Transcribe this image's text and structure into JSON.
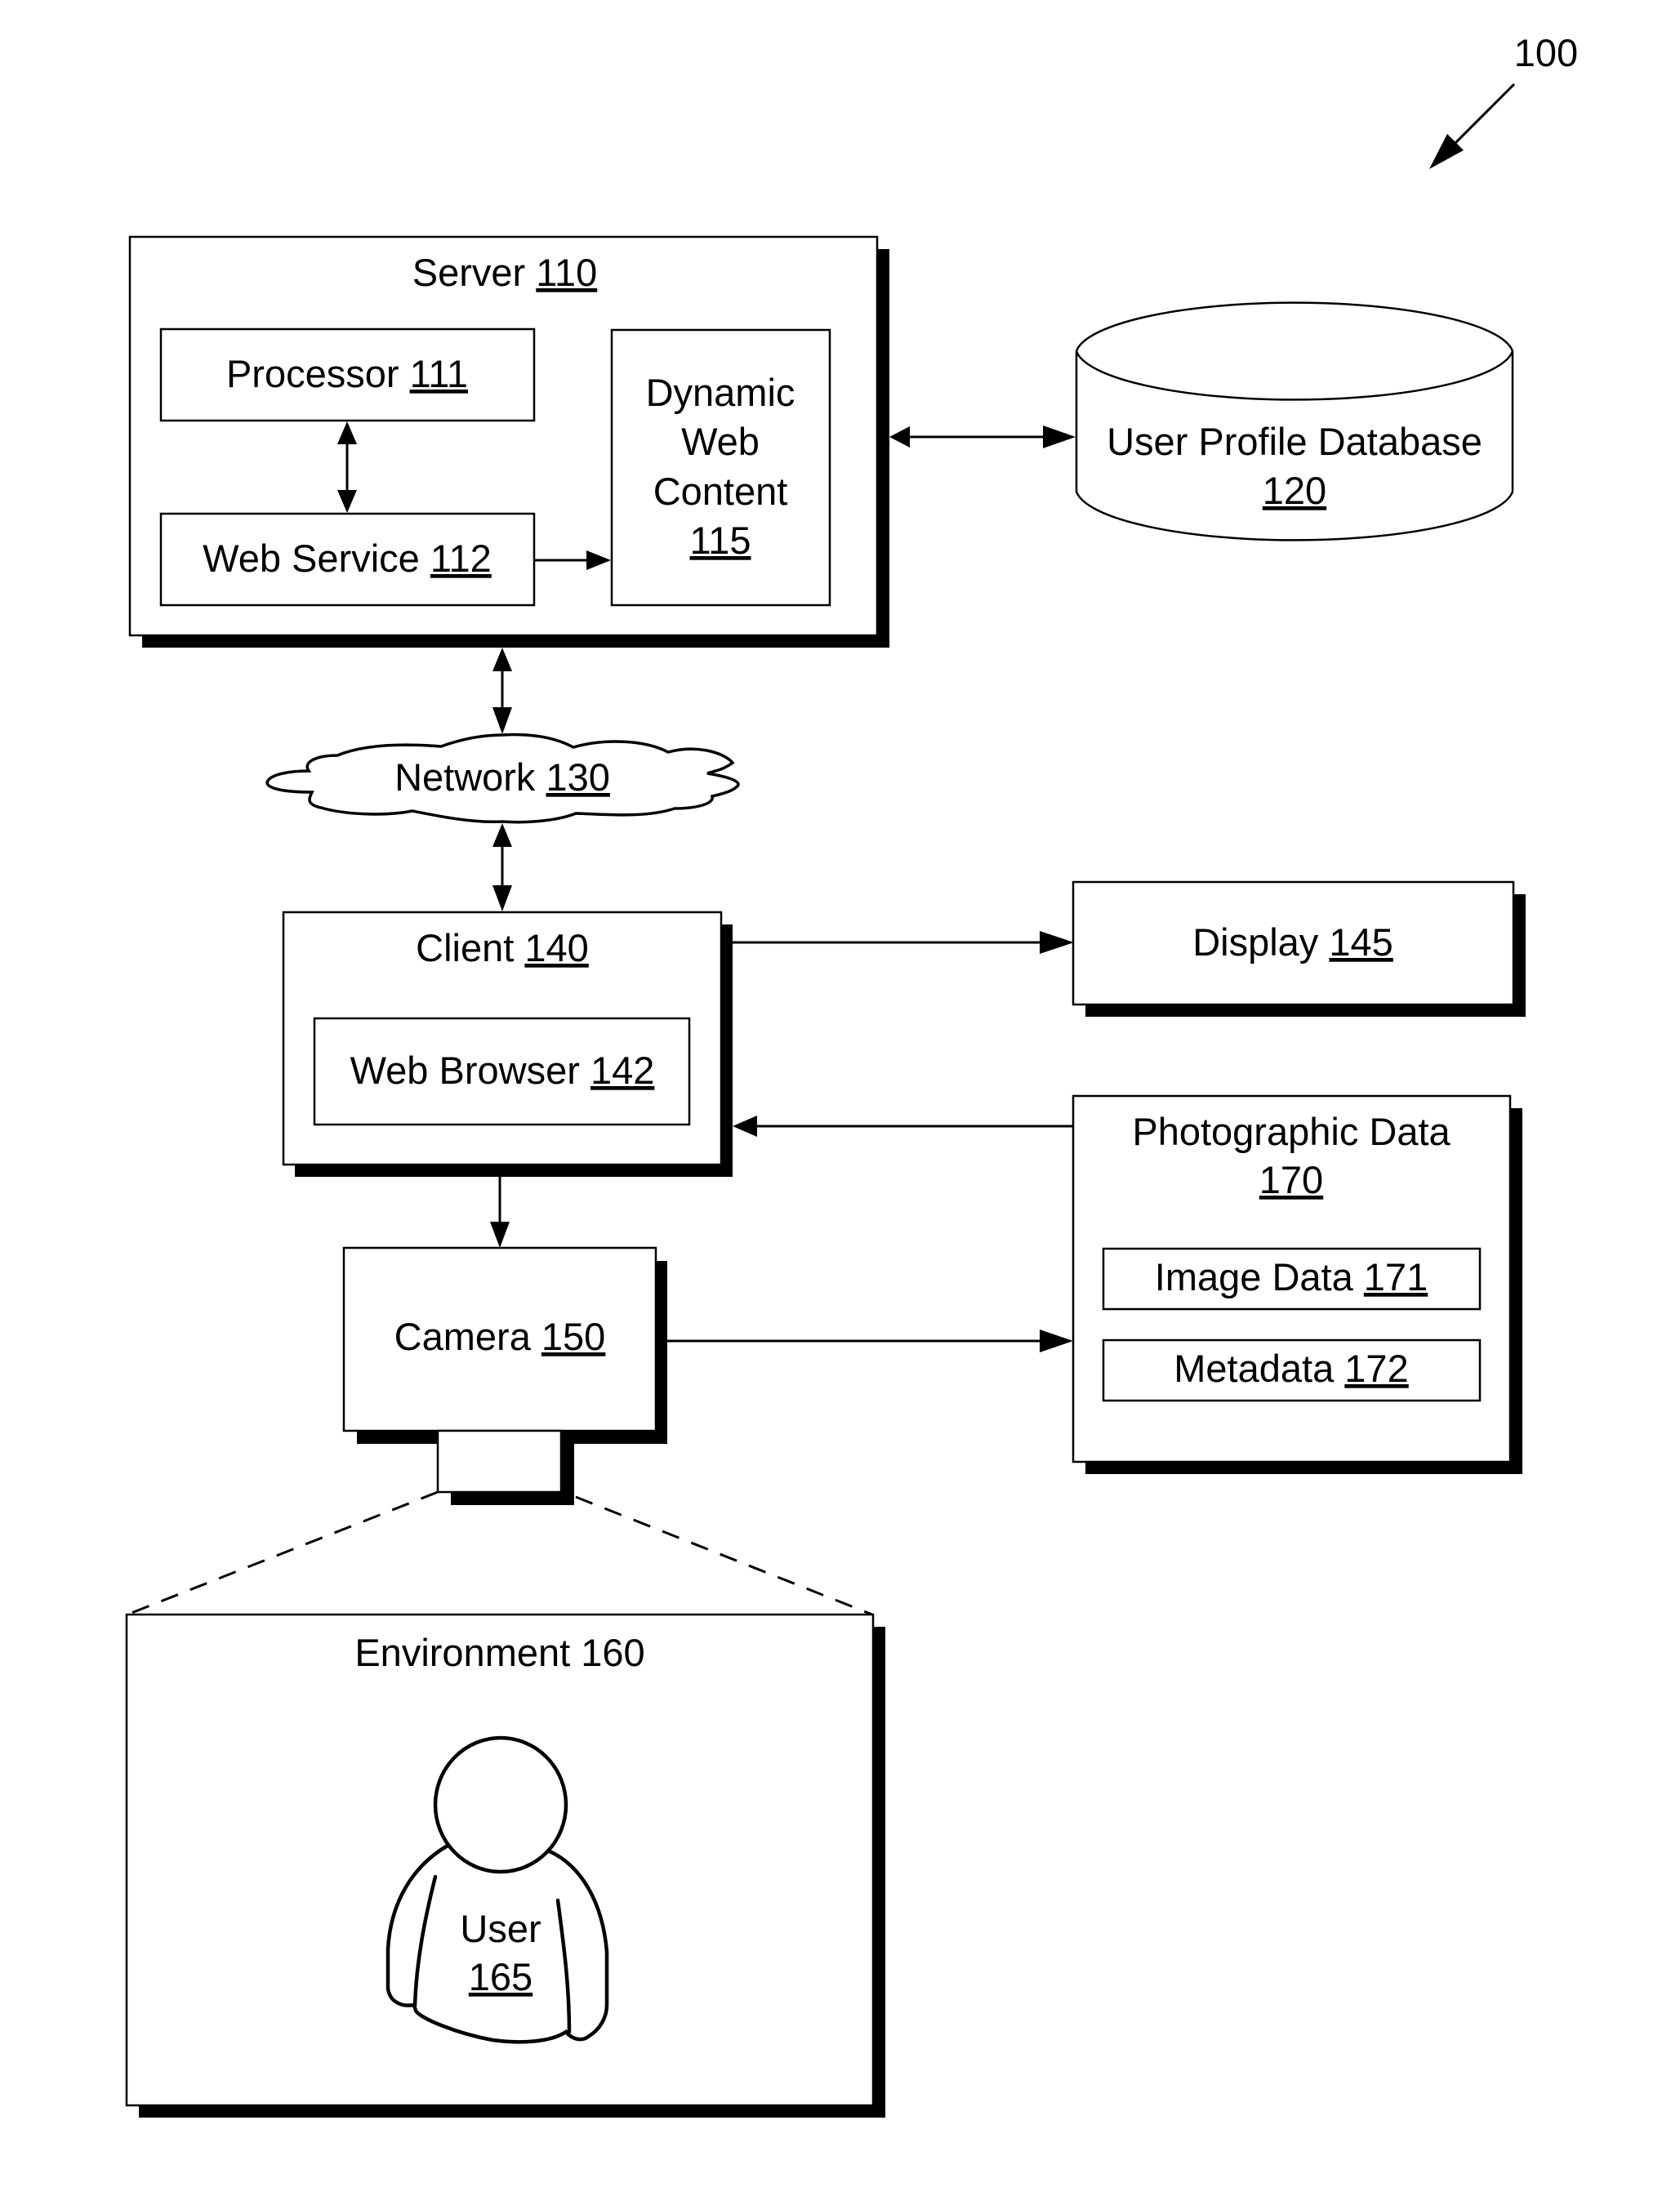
{
  "figure": {
    "reference": "100",
    "colors": {
      "ink": "#000000",
      "background": "#ffffff"
    }
  },
  "server": {
    "label": "Server",
    "ref": "110",
    "processor": {
      "label": "Processor",
      "ref": "111"
    },
    "web_service": {
      "label": "Web Service",
      "ref": "112"
    },
    "dynamic_web_content": {
      "lines": [
        "Dynamic",
        "Web",
        "Content"
      ],
      "ref": "115"
    }
  },
  "user_profile_database": {
    "label": "User Profile Database",
    "ref": "120"
  },
  "network": {
    "label": "Network",
    "ref": "130"
  },
  "client": {
    "label": "Client",
    "ref": "140",
    "web_browser": {
      "label": "Web Browser",
      "ref": "142"
    }
  },
  "display": {
    "label": "Display",
    "ref": "145"
  },
  "camera": {
    "label": "Camera",
    "ref": "150"
  },
  "environment": {
    "label": "Environment 160",
    "user": {
      "label": "User",
      "ref": "165"
    }
  },
  "photographic_data": {
    "label": "Photographic Data",
    "ref": "170",
    "image_data": {
      "label": "Image Data",
      "ref": "171"
    },
    "metadata": {
      "label": "Metadata",
      "ref": "172"
    }
  },
  "connections": [
    {
      "from": "processor",
      "to": "web_service",
      "type": "bidirectional"
    },
    {
      "from": "web_service",
      "to": "dynamic_web_content",
      "type": "directed"
    },
    {
      "from": "server",
      "to": "user_profile_database",
      "type": "bidirectional"
    },
    {
      "from": "server",
      "to": "network",
      "type": "bidirectional"
    },
    {
      "from": "network",
      "to": "client",
      "type": "bidirectional"
    },
    {
      "from": "client",
      "to": "display",
      "type": "directed"
    },
    {
      "from": "photographic_data",
      "to": "client",
      "type": "directed"
    },
    {
      "from": "client",
      "to": "camera",
      "type": "directed"
    },
    {
      "from": "camera",
      "to": "photographic_data",
      "type": "directed"
    },
    {
      "from": "camera",
      "to": "environment",
      "type": "field-of-view"
    }
  ]
}
